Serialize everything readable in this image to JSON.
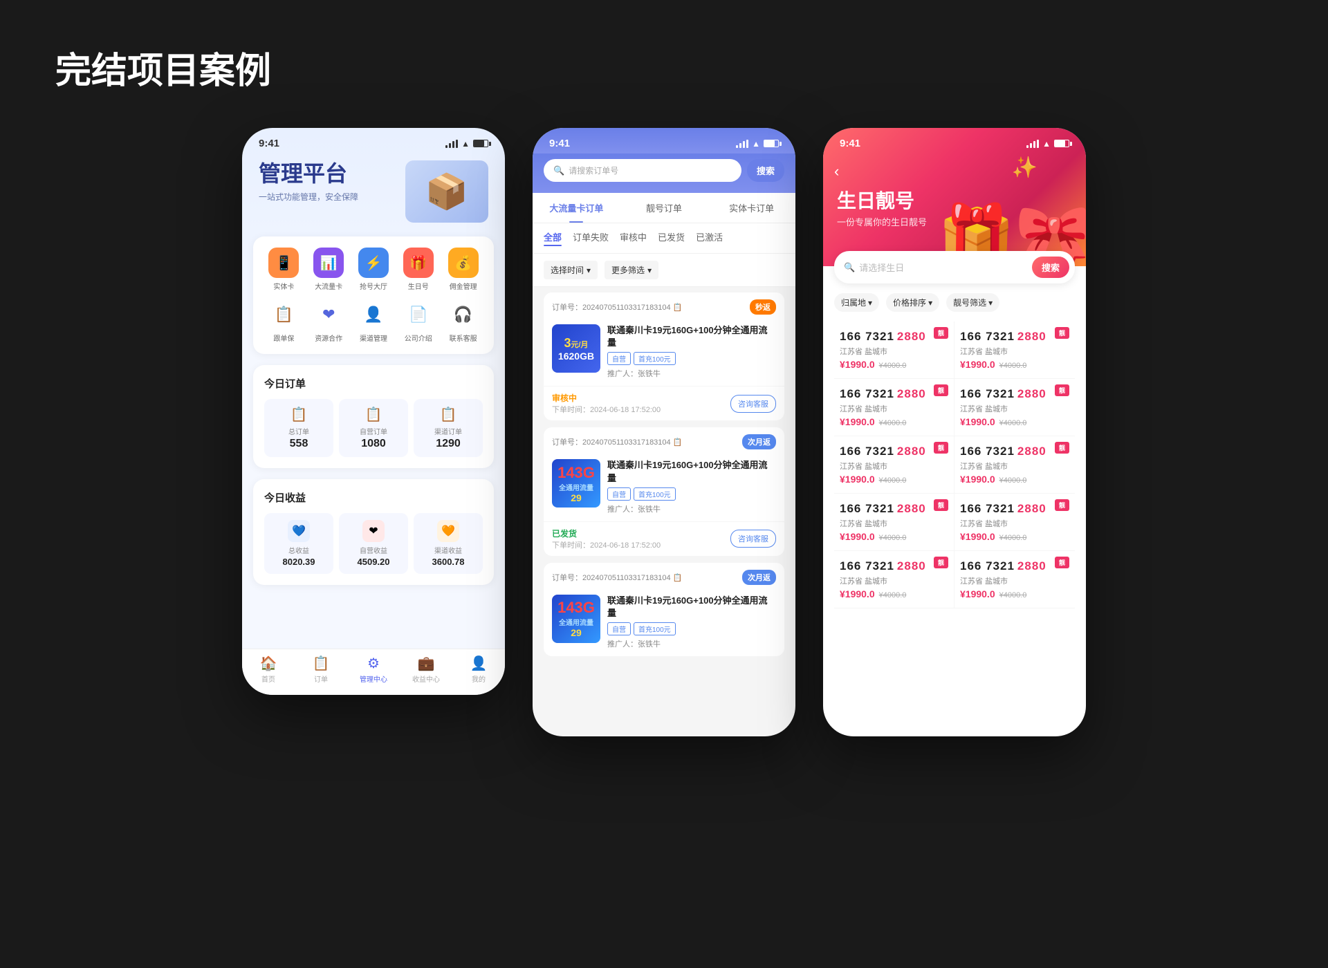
{
  "page": {
    "title": "完结项目案例",
    "bg_color": "#1a1a1a"
  },
  "phone1": {
    "status_bar": {
      "time": "9:41"
    },
    "header": {
      "title": "管理平台",
      "subtitle": "一站式功能管理，安全保障"
    },
    "icons_row1": [
      {
        "label": "实体卡",
        "bg": "#ff8c42",
        "emoji": "📱"
      },
      {
        "label": "大流量卡",
        "bg": "#8855ee",
        "emoji": "📊"
      },
      {
        "label": "抢号大厅",
        "bg": "#4488ee",
        "emoji": "⚡"
      },
      {
        "label": "生日号",
        "bg": "#ff6655",
        "emoji": "🎁"
      },
      {
        "label": "佣金管理",
        "bg": "#ffaa22",
        "emoji": "💰"
      }
    ],
    "icons_row2": [
      {
        "label": "跟单保",
        "emoji": "📋"
      },
      {
        "label": "资源合作",
        "emoji": "❤"
      },
      {
        "label": "渠道管理",
        "emoji": "👤"
      },
      {
        "label": "公司介绍",
        "emoji": "📄"
      },
      {
        "label": "联系客服",
        "emoji": "🎧"
      }
    ],
    "today_orders": {
      "title": "今日订单",
      "items": [
        {
          "label": "总订单",
          "value": "558",
          "emoji": "📋",
          "color": "#4466dd"
        },
        {
          "label": "自营订单",
          "value": "1080",
          "emoji": "📋",
          "color": "#22aa55"
        },
        {
          "label": "渠道订单",
          "value": "1290",
          "emoji": "📋",
          "color": "#4488ee"
        }
      ]
    },
    "today_revenue": {
      "title": "今日收益",
      "items": [
        {
          "label": "总收益",
          "value": "8020.39",
          "emoji": "💙",
          "bg": "#e8f0ff"
        },
        {
          "label": "自营收益",
          "value": "4509.20",
          "emoji": "❤",
          "bg": "#ffe8e8"
        },
        {
          "label": "渠道收益",
          "value": "3600.78",
          "emoji": "🧡",
          "bg": "#fff3e0"
        }
      ]
    },
    "bottom_nav": [
      {
        "label": "首页",
        "emoji": "🏠",
        "active": false
      },
      {
        "label": "订单",
        "emoji": "📋",
        "active": false
      },
      {
        "label": "管理中心",
        "emoji": "⚙",
        "active": true
      },
      {
        "label": "收益中心",
        "emoji": "💼",
        "active": false
      },
      {
        "label": "我的",
        "emoji": "👤",
        "active": false
      }
    ]
  },
  "phone2": {
    "status_bar": {
      "time": "9:41"
    },
    "search": {
      "placeholder": "请搜索订单号",
      "button_label": "搜索"
    },
    "tabs": [
      {
        "label": "大流量卡订单",
        "active": true
      },
      {
        "label": "靓号订单",
        "active": false
      },
      {
        "label": "实体卡订单",
        "active": false
      }
    ],
    "subtabs": [
      {
        "label": "全部",
        "active": true
      },
      {
        "label": "订单失败",
        "active": false
      },
      {
        "label": "审核中",
        "active": false
      },
      {
        "label": "已发货",
        "active": false
      },
      {
        "label": "已激活",
        "active": false
      }
    ],
    "filters": [
      {
        "label": "选择时间"
      },
      {
        "label": "更多筛选"
      }
    ],
    "orders": [
      {
        "id": "202407051103317183104",
        "badge": "秒返",
        "badge_type": "orange",
        "name": "联通秦川卡19元160G+100分钟全通用流量",
        "tags": [
          "自营",
          "首充100元"
        ],
        "promoter": "推广人：张铁牛",
        "status": "审核中",
        "status_type": "reviewing",
        "time": "2024-06-18 17:52:00",
        "show_contact": false,
        "card_bg": "#3366dd",
        "card_price": "3元/月",
        "card_gb": "1620GB"
      },
      {
        "id": "202407051103317183104",
        "badge": "次月返",
        "badge_type": "blue",
        "name": "联通秦川卡19元160G+100分钟全通用流量",
        "tags": [
          "自营",
          "首充100元"
        ],
        "promoter": "推广人：张铁牛",
        "status": "已发货",
        "status_type": "shipped",
        "time": "2024-06-18 17:52:00",
        "show_contact": true,
        "card_gb_large": "143G"
      },
      {
        "id": "202407051103317183104",
        "badge": "次月返",
        "badge_type": "blue",
        "name": "联通秦川卡19元160G+100分钟全通用流量",
        "tags": [
          "自营",
          "首充100元"
        ],
        "promoter": "推广人：张铁牛",
        "status": "",
        "status_type": "",
        "time": "",
        "show_contact": false,
        "card_gb_large": "143G"
      }
    ]
  },
  "phone3": {
    "status_bar": {
      "time": "9:41"
    },
    "hero": {
      "back": "‹",
      "title": "生日靓号",
      "subtitle": "一份专属你的生日靓号"
    },
    "search": {
      "placeholder": "请选择生日",
      "button_label": "搜索"
    },
    "filters": [
      {
        "label": "归属地"
      },
      {
        "label": "价格排序"
      },
      {
        "label": "靓号筛选"
      }
    ],
    "numbers": [
      {
        "prefix": "166 7321 ",
        "suffix": "2880",
        "location": "江苏省 盐城市",
        "price": "¥1990.0",
        "original": "¥4000.0"
      },
      {
        "prefix": "166 7321 ",
        "suffix": "2880",
        "location": "江苏省 盐城市",
        "price": "¥1990.0",
        "original": "¥4000.0"
      },
      {
        "prefix": "166 7321 ",
        "suffix": "2880",
        "location": "江苏省 盐城市",
        "price": "¥1990.0",
        "original": "¥4000.0"
      },
      {
        "prefix": "166 7321 ",
        "suffix": "2880",
        "location": "江苏省 盐城市",
        "price": "¥1990.0",
        "original": "¥4000.0"
      },
      {
        "prefix": "166 7321 ",
        "suffix": "2880",
        "location": "江苏省 盐城市",
        "price": "¥1990.0",
        "original": "¥4000.0"
      },
      {
        "prefix": "166 7321 ",
        "suffix": "2880",
        "location": "江苏省 盐城市",
        "price": "¥1990.0",
        "original": "¥4000.0"
      },
      {
        "prefix": "166 7321 ",
        "suffix": "2880",
        "location": "江苏省 盐城市",
        "price": "¥1990.0",
        "original": "¥4000.0"
      },
      {
        "prefix": "166 7321 ",
        "suffix": "2880",
        "location": "江苏省 盐城市",
        "price": "¥1990.0",
        "original": "¥4000.0"
      },
      {
        "prefix": "166 7321 ",
        "suffix": "2880",
        "location": "江苏省 盐城市",
        "price": "¥1990.0",
        "original": "¥4000.0"
      },
      {
        "prefix": "166 7321 ",
        "suffix": "2880",
        "location": "江苏省 盐城市",
        "price": "¥1990.0",
        "original": "¥4000.0"
      }
    ]
  }
}
